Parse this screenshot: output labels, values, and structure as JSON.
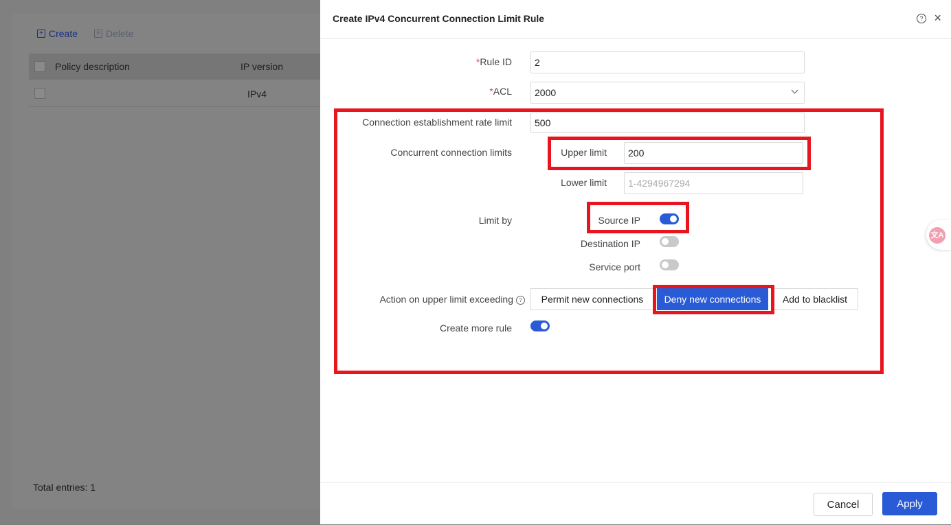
{
  "background": {
    "toolbar": {
      "create_label": "Create",
      "delete_label": "Delete"
    },
    "table": {
      "headers": [
        "Policy description",
        "IP version"
      ],
      "rows": [
        {
          "policy_description": "",
          "ip_version": "IPv4"
        }
      ]
    },
    "total_entries": "Total entries: 1"
  },
  "drawer": {
    "title": "Create IPv4 Concurrent Connection Limit Rule",
    "fields": {
      "rule_id": {
        "label": "Rule ID",
        "value": "2"
      },
      "acl": {
        "label": "ACL",
        "value": "2000"
      },
      "rate_limit": {
        "label": "Connection establishment rate limit",
        "value": "500"
      },
      "concurrent": {
        "label": "Concurrent connection limits",
        "upper_label": "Upper limit",
        "upper_value": "200",
        "lower_label": "Lower limit",
        "lower_placeholder": "1-4294967294"
      },
      "limit_by": {
        "label": "Limit by",
        "options": [
          {
            "label": "Source IP",
            "on": true
          },
          {
            "label": "Destination IP",
            "on": false
          },
          {
            "label": "Service port",
            "on": false
          }
        ]
      },
      "action": {
        "label": "Action on upper limit exceeding",
        "options": [
          "Permit new connections",
          "Deny new connections",
          "Add to blacklist"
        ],
        "selected": "Deny new connections"
      },
      "create_more": {
        "label": "Create more rule",
        "on": true
      }
    },
    "footer": {
      "cancel_label": "Cancel",
      "apply_label": "Apply"
    }
  },
  "colors": {
    "accent": "#2a5bd7",
    "highlight": "#e8141e",
    "required": "#e5484d"
  }
}
